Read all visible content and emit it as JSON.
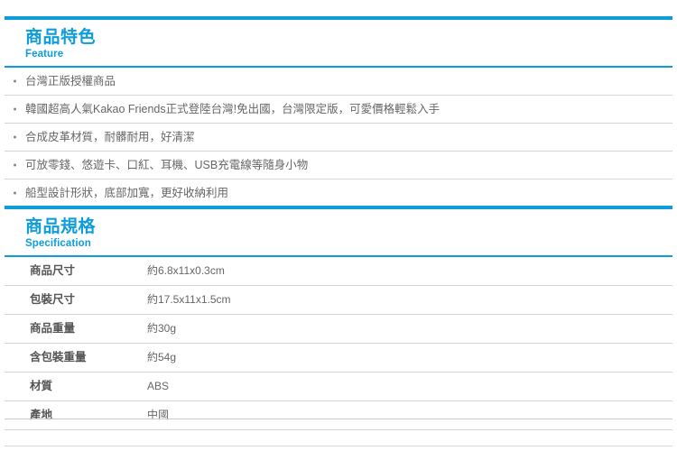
{
  "theme": {
    "accent": "#0d9ddb",
    "text": "#666666",
    "label_text": "#555555",
    "divider": "#d4d4d4"
  },
  "feature": {
    "title_cn": "商品特色",
    "title_en": "Feature",
    "items": [
      "台灣正版授權商品",
      "韓國超高人氣Kakao Friends正式登陸台灣!免出國，台灣限定版，可愛價格輕鬆入手",
      "合成皮革材質，耐髒耐用，好清潔",
      "可放零錢、悠遊卡、口紅、耳機、USB充電線等隨身小物",
      "船型設計形狀，底部加寬，更好收納利用"
    ]
  },
  "specification": {
    "title_cn": "商品規格",
    "title_en": "Specification",
    "rows": [
      {
        "label": "商品尺寸",
        "value": "約6.8x11x0.3cm"
      },
      {
        "label": "包裝尺寸",
        "value": "約17.5x11x1.5cm"
      },
      {
        "label": "商品重量",
        "value": "約30g"
      },
      {
        "label": "含包裝重量",
        "value": "約54g"
      },
      {
        "label": "材質",
        "value": "ABS"
      },
      {
        "label": "產地",
        "value": "中國"
      }
    ]
  }
}
